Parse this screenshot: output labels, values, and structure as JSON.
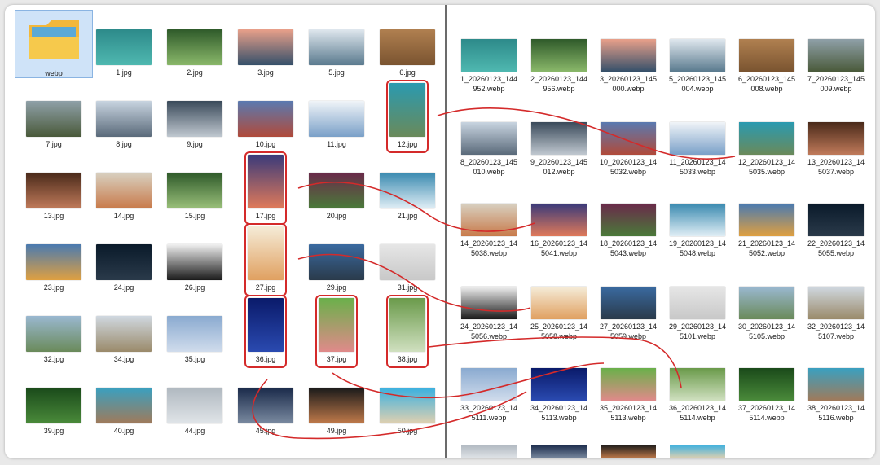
{
  "left_panel": {
    "folder": {
      "label": "webp"
    },
    "items": [
      {
        "label": "1.jpg",
        "colors": [
          "#2d8a8a",
          "#4fb8b0"
        ]
      },
      {
        "label": "2.jpg",
        "colors": [
          "#2f5a2a",
          "#8ab86a"
        ]
      },
      {
        "label": "3.jpg",
        "colors": [
          "#e9a08a",
          "#35506a"
        ]
      },
      {
        "label": "5.jpg",
        "colors": [
          "#dfe7ee",
          "#5a7a8e"
        ]
      },
      {
        "label": "6.jpg",
        "colors": [
          "#b08050",
          "#7a5430"
        ]
      },
      {
        "label": "7.jpg",
        "colors": [
          "#8fa0a8",
          "#4a5a3a"
        ]
      },
      {
        "label": "8.jpg",
        "colors": [
          "#c8d4e0",
          "#5a6a7a"
        ]
      },
      {
        "label": "9.jpg",
        "colors": [
          "#3a4a5a",
          "#c0c8d0"
        ]
      },
      {
        "label": "10.jpg",
        "colors": [
          "#5a7ab0",
          "#b04a3a"
        ]
      },
      {
        "label": "11.jpg",
        "colors": [
          "#f0f4f8",
          "#7aa0c8"
        ]
      },
      {
        "label": "12.jpg",
        "colors": [
          "#2a9ab0",
          "#6a8a5a"
        ]
      },
      {
        "label": "13.jpg",
        "colors": [
          "#4a2a1a",
          "#c07a5a"
        ]
      },
      {
        "label": "14.jpg",
        "colors": [
          "#d8d0c0",
          "#c87a4a"
        ]
      },
      {
        "label": "15.jpg",
        "colors": [
          "#2f5a2a",
          "#9ac07a"
        ]
      },
      {
        "label": "17.jpg",
        "colors": [
          "#3a3a7a",
          "#e07a5a"
        ]
      },
      {
        "label": "20.jpg",
        "colors": [
          "#6a2a4a",
          "#4a7a3a"
        ]
      },
      {
        "label": "21.jpg",
        "colors": [
          "#3a8ab0",
          "#e0eef5"
        ]
      },
      {
        "label": "23.jpg",
        "colors": [
          "#4a7ab0",
          "#e0a040"
        ]
      },
      {
        "label": "24.jpg",
        "colors": [
          "#0a1a2a",
          "#2a3a4a"
        ]
      },
      {
        "label": "26.jpg",
        "colors": [
          "#f0f0f0",
          "#1a1a1a"
        ]
      },
      {
        "label": "27.jpg",
        "colors": [
          "#f5ecd8",
          "#e0a060"
        ]
      },
      {
        "label": "29.jpg",
        "colors": [
          "#3a6aa0",
          "#2a3a4a"
        ]
      },
      {
        "label": "31.jpg",
        "colors": [
          "#e6e6e6",
          "#c8c8c8"
        ]
      },
      {
        "label": "32.jpg",
        "colors": [
          "#9ab8d0",
          "#6a8a5a"
        ]
      },
      {
        "label": "34.jpg",
        "colors": [
          "#d0d8e0",
          "#9a8a6a"
        ]
      },
      {
        "label": "35.jpg",
        "colors": [
          "#8aaad0",
          "#d0dcec"
        ]
      },
      {
        "label": "36.jpg",
        "colors": [
          "#0a1a6a",
          "#2a4ab0"
        ]
      },
      {
        "label": "37.jpg",
        "colors": [
          "#6ab04a",
          "#e08a8a"
        ]
      },
      {
        "label": "38.jpg",
        "colors": [
          "#6a9a4a",
          "#d0e0c0"
        ]
      },
      {
        "label": "39.jpg",
        "colors": [
          "#1a4a1a",
          "#4a8a3a"
        ]
      },
      {
        "label": "40.jpg",
        "colors": [
          "#3aa0c0",
          "#a07a5a"
        ]
      },
      {
        "label": "44.jpg",
        "colors": [
          "#b0b8c0",
          "#e0e4e8"
        ]
      },
      {
        "label": "45.jpg",
        "colors": [
          "#1a2a4a",
          "#7a8aa0"
        ]
      },
      {
        "label": "49.jpg",
        "colors": [
          "#1a1a1a",
          "#c07a4a"
        ]
      },
      {
        "label": "50.jpg",
        "colors": [
          "#3ab0e0",
          "#e0d0b0"
        ]
      }
    ]
  },
  "right_panel": {
    "items": [
      {
        "label": "1_20260123_144\n952.webp",
        "colors": [
          "#2d8a8a",
          "#4fb8b0"
        ]
      },
      {
        "label": "2_20260123_144\n956.webp",
        "colors": [
          "#2f5a2a",
          "#8ab86a"
        ]
      },
      {
        "label": "3_20260123_145\n000.webp",
        "colors": [
          "#e9a08a",
          "#35506a"
        ]
      },
      {
        "label": "5_20260123_145\n004.webp",
        "colors": [
          "#dfe7ee",
          "#5a7a8e"
        ]
      },
      {
        "label": "6_20260123_145\n008.webp",
        "colors": [
          "#b08050",
          "#7a5430"
        ]
      },
      {
        "label": "7_20260123_145\n009.webp",
        "colors": [
          "#8fa0a8",
          "#4a5a3a"
        ]
      },
      {
        "label": "8_20260123_145\n010.webp",
        "colors": [
          "#c8d4e0",
          "#5a6a7a"
        ]
      },
      {
        "label": "9_20260123_145\n012.webp",
        "colors": [
          "#3a4a5a",
          "#c0c8d0"
        ]
      },
      {
        "label": "10_20260123_14\n5032.webp",
        "colors": [
          "#5a7ab0",
          "#b04a3a"
        ]
      },
      {
        "label": "11_20260123_14\n5033.webp",
        "colors": [
          "#f0f4f8",
          "#7aa0c8"
        ]
      },
      {
        "label": "12_20260123_14\n5035.webp",
        "colors": [
          "#2a9ab0",
          "#6a8a5a"
        ]
      },
      {
        "label": "13_20260123_14\n5037.webp",
        "colors": [
          "#4a2a1a",
          "#c07a5a"
        ]
      },
      {
        "label": "14_20260123_14\n5038.webp",
        "colors": [
          "#d8d0c0",
          "#c87a4a"
        ]
      },
      {
        "label": "16_20260123_14\n5041.webp",
        "colors": [
          "#3a3a7a",
          "#e07a5a"
        ]
      },
      {
        "label": "18_20260123_14\n5043.webp",
        "colors": [
          "#6a2a4a",
          "#4a7a3a"
        ]
      },
      {
        "label": "19_20260123_14\n5048.webp",
        "colors": [
          "#3a8ab0",
          "#e0eef5"
        ]
      },
      {
        "label": "21_20260123_14\n5052.webp",
        "colors": [
          "#4a7ab0",
          "#e0a040"
        ]
      },
      {
        "label": "22_20260123_14\n5055.webp",
        "colors": [
          "#0a1a2a",
          "#2a3a4a"
        ]
      },
      {
        "label": "24_20260123_14\n5056.webp",
        "colors": [
          "#f0f0f0",
          "#1a1a1a"
        ]
      },
      {
        "label": "25_20260123_14\n5058.webp",
        "colors": [
          "#f5ecd8",
          "#e0a060"
        ]
      },
      {
        "label": "27_20260123_14\n5059.webp",
        "colors": [
          "#3a6aa0",
          "#2a3a4a"
        ]
      },
      {
        "label": "29_20260123_14\n5101.webp",
        "colors": [
          "#e6e6e6",
          "#c8c8c8"
        ]
      },
      {
        "label": "30_20260123_14\n5105.webp",
        "colors": [
          "#9ab8d0",
          "#6a8a5a"
        ]
      },
      {
        "label": "32_20260123_14\n5107.webp",
        "colors": [
          "#d0d8e0",
          "#9a8a6a"
        ]
      },
      {
        "label": "33_20260123_14\n5111.webp",
        "colors": [
          "#8aaad0",
          "#d0dcec"
        ]
      },
      {
        "label": "34_20260123_14\n5113.webp",
        "colors": [
          "#0a1a6a",
          "#2a4ab0"
        ]
      },
      {
        "label": "35_20260123_14\n5113.webp",
        "colors": [
          "#6ab04a",
          "#e08a8a"
        ]
      },
      {
        "label": "36_20260123_14\n5114.webp",
        "colors": [
          "#6a9a4a",
          "#d0e0c0"
        ]
      },
      {
        "label": "37_20260123_14\n5114.webp",
        "colors": [
          "#1a4a1a",
          "#4a8a3a"
        ]
      },
      {
        "label": "38_20260123_14\n5116.webp",
        "colors": [
          "#3aa0c0",
          "#a07a5a"
        ]
      }
    ],
    "partial_row": [
      {
        "colors": [
          "#b0b8c0",
          "#e0e4e8"
        ]
      },
      {
        "colors": [
          "#1a2a4a",
          "#7a8aa0"
        ]
      },
      {
        "colors": [
          "#1a1a1a",
          "#c07a4a"
        ]
      },
      {
        "colors": [
          "#3ab0e0",
          "#e0d0b0"
        ]
      }
    ]
  },
  "annotation_color": "#d42a2a"
}
